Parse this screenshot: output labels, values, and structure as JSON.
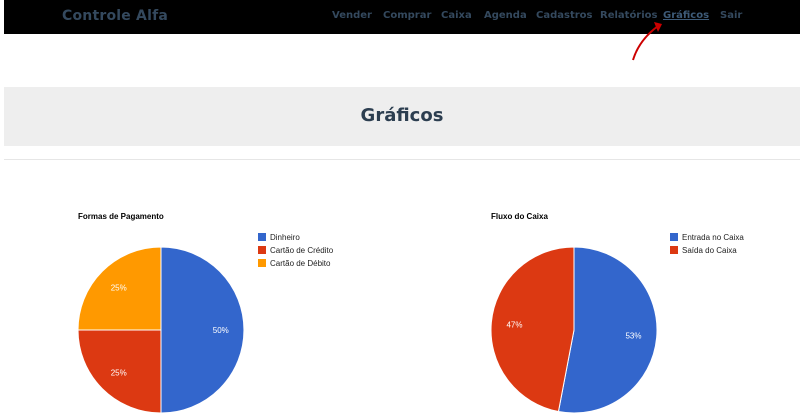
{
  "navbar": {
    "brand": "Controle Alfa",
    "items": [
      {
        "label": "Vender"
      },
      {
        "label": "Comprar"
      },
      {
        "label": "Caixa"
      },
      {
        "label": "Agenda"
      },
      {
        "label": "Cadastros"
      },
      {
        "label": "Relatórios"
      },
      {
        "label": "Gráficos",
        "active": true
      },
      {
        "label": "Sair"
      }
    ]
  },
  "page": {
    "title": "Gráficos"
  },
  "colors": {
    "navbar_bg": "#000000",
    "nav_text": "#34495e",
    "header_bg": "#eeeeee",
    "annotation_arrow": "#cc0000"
  },
  "chart_data": [
    {
      "type": "pie",
      "title": "Formas de Pagamento",
      "categories": [
        "Dinheiro",
        "Cartão de Crédito",
        "Cartão de Débito"
      ],
      "values": [
        50,
        25,
        25
      ],
      "labels": [
        "50%",
        "25%",
        "25%"
      ],
      "colors": [
        "#3366cc",
        "#dc3912",
        "#ff9900"
      ],
      "legend": "right"
    },
    {
      "type": "pie",
      "title": "Fluxo do Caixa",
      "categories": [
        "Entrada no Caixa",
        "Saída do Caixa"
      ],
      "values": [
        53,
        47
      ],
      "labels": [
        "53%",
        "47%"
      ],
      "colors": [
        "#3366cc",
        "#dc3912"
      ],
      "legend": "right"
    }
  ]
}
